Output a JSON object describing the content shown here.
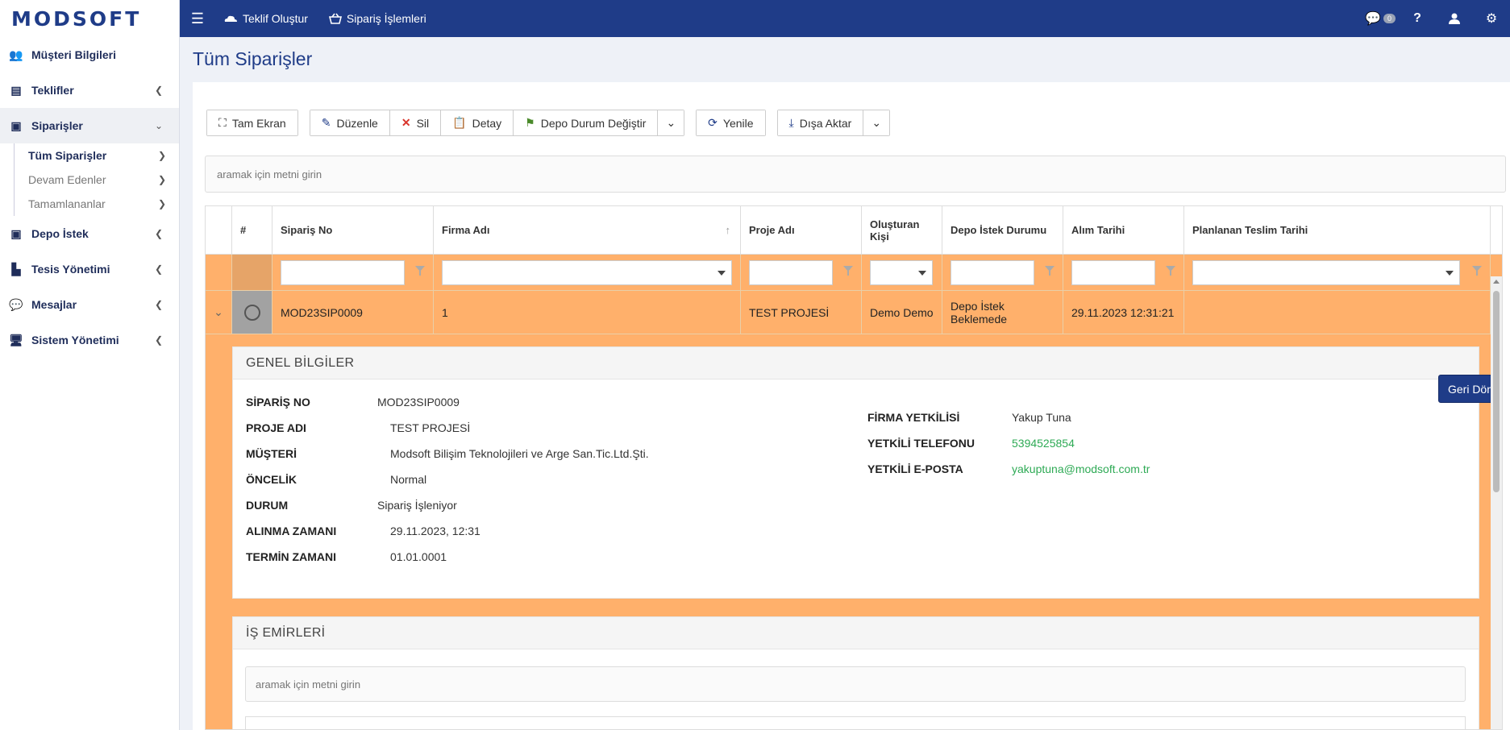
{
  "app": {
    "logo": "MODSOFT"
  },
  "topbar": {
    "links": [
      {
        "label": "Teklif Oluştur",
        "icon": "cloud-icon"
      },
      {
        "label": "Sipariş İşlemleri",
        "icon": "basket-icon"
      }
    ],
    "messages_badge": "0",
    "help": "?"
  },
  "sidebar": {
    "items": [
      {
        "label": "Müşteri Bilgileri"
      },
      {
        "label": "Teklifler"
      },
      {
        "label": "Siparişler"
      },
      {
        "label": "Depo İstek"
      },
      {
        "label": "Tesis Yönetimi"
      },
      {
        "label": "Mesajlar"
      },
      {
        "label": "Sistem Yönetimi"
      }
    ],
    "sub_items": [
      {
        "label": "Tüm Siparişler"
      },
      {
        "label": "Devam Edenler"
      },
      {
        "label": "Tamamlananlar"
      }
    ]
  },
  "page": {
    "title": "Tüm Siparişler"
  },
  "toolbar": {
    "fullscreen": "Tam Ekran",
    "edit": "Düzenle",
    "delete": "Sil",
    "detail": "Detay",
    "depot_status": "Depo Durum Değiştir",
    "refresh": "Yenile",
    "export": "Dışa Aktar"
  },
  "search": {
    "placeholder": "aramak için metni girin"
  },
  "grid": {
    "columns": [
      "#",
      "Sipariş No",
      "Firma Adı",
      "Proje Adı",
      "Oluşturan Kişi",
      "Depo İstek Durumu",
      "Alım Tarihi",
      "Planlanan Teslim Tarihi"
    ],
    "row": {
      "order_no": "MOD23SIP0009",
      "company": "1",
      "project": "TEST PROJESİ",
      "creator": "Demo Demo",
      "depot_status": "Depo İstek Beklemede",
      "purchase_date": "29.11.2023 12:31:21",
      "planned_delivery": ""
    }
  },
  "general": {
    "title": "GENEL BİLGİLER",
    "back_button": "Geri Dön",
    "left": [
      {
        "k": "SİPARİŞ NO",
        "v": "MOD23SIP0009"
      },
      {
        "k": "PROJE ADI",
        "v": "TEST PROJESİ"
      },
      {
        "k": "MÜŞTERİ",
        "v": "Modsoft Bilişim Teknolojileri ve Arge San.Tic.Ltd.Şti."
      },
      {
        "k": "ÖNCELİK",
        "v": "Normal"
      },
      {
        "k": "DURUM",
        "v": "Sipariş İşleniyor"
      },
      {
        "k": "ALINMA ZAMANI",
        "v": "29.11.2023, 12:31"
      },
      {
        "k": "TERMİN ZAMANI",
        "v": "01.01.0001"
      }
    ],
    "right": [
      {
        "k": "FİRMA YETKİLİSİ",
        "v": "Yakup Tuna"
      },
      {
        "k": "YETKİLİ TELEFONU",
        "v": "5394525854"
      },
      {
        "k": "YETKİLİ E-POSTA",
        "v": "yakuptuna@modsoft.com.tr"
      }
    ]
  },
  "work_orders": {
    "title": "İŞ EMİRLERİ",
    "placeholder": "aramak için metni girin"
  },
  "colors": {
    "primary": "#1f3c88",
    "row_highlight": "#ffb06b",
    "link_green": "#2eaa55"
  }
}
